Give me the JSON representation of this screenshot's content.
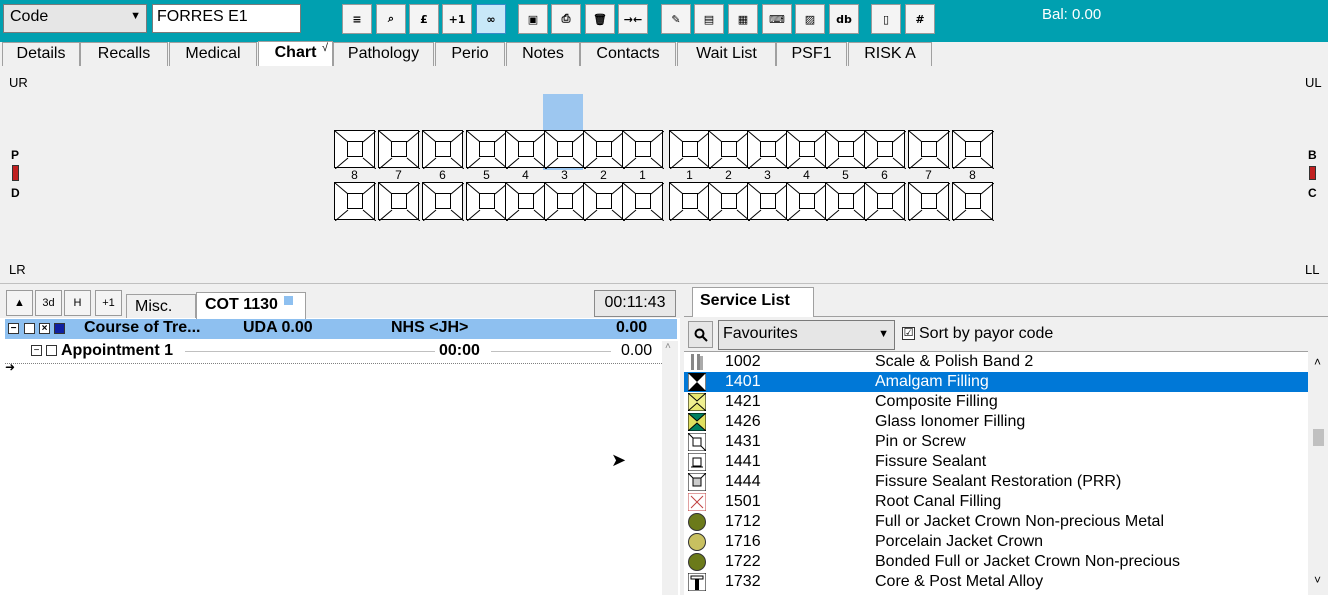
{
  "toolbar": {
    "code_combo": "Code",
    "patient_field": "FORRES E1",
    "balance": "Bal: 0.00",
    "buttons": [
      {
        "name": "align-icon",
        "glyph": "≡"
      },
      {
        "name": "search-icon",
        "glyph": "⌕"
      },
      {
        "name": "pound-icon",
        "glyph": "£"
      },
      {
        "name": "plus-one-icon",
        "glyph": "+1"
      },
      {
        "name": "link-icon",
        "glyph": "∞"
      },
      {
        "name": "save-icon",
        "glyph": "▣"
      },
      {
        "name": "print-icon",
        "glyph": "⎙"
      },
      {
        "name": "delete-icon",
        "glyph": "🗑"
      },
      {
        "name": "arrows-icon",
        "glyph": "→←"
      },
      {
        "name": "pen-icon",
        "glyph": "✎"
      },
      {
        "name": "document-icon",
        "glyph": "▤"
      },
      {
        "name": "documents-icon",
        "glyph": "▦"
      },
      {
        "name": "keyboard-icon",
        "glyph": "⌨"
      },
      {
        "name": "note-icon",
        "glyph": "▨"
      },
      {
        "name": "db-icon",
        "glyph": "db"
      },
      {
        "name": "page-icon",
        "glyph": "▯"
      },
      {
        "name": "grid-icon",
        "glyph": "#"
      }
    ]
  },
  "tabs": [
    "Details",
    "Recalls",
    "Medical",
    "Chart",
    "Pathology",
    "Perio",
    "Notes",
    "Contacts",
    "Wait List",
    "PSF1",
    "RISK A"
  ],
  "active_tab": "Chart",
  "active_tab_mark": "√",
  "chart": {
    "quadrants": {
      "ur": "UR",
      "ul": "UL",
      "lr": "LR",
      "ll": "LL"
    },
    "left_side": [
      "P",
      "D"
    ],
    "right_side": [
      "B",
      "C"
    ],
    "upper_left_numbers": [
      "8",
      "7",
      "6",
      "5",
      "4",
      "3",
      "2",
      "1"
    ],
    "upper_right_numbers": [
      "1",
      "2",
      "3",
      "4",
      "5",
      "6",
      "7",
      "8"
    ]
  },
  "course": {
    "buttons": [
      "▲",
      "3d",
      "H",
      "+1"
    ],
    "tabs": [
      "Misc.",
      "COT 1130"
    ],
    "timer": "00:11:43",
    "header": {
      "title": "Course of Tre...",
      "uda": "UDA 0.00",
      "nhs": "NHS <JH>",
      "amount": "0.00"
    },
    "appointment": {
      "label": "Appointment 1",
      "time": "00:00",
      "amount": "0.00"
    }
  },
  "service": {
    "tab": "Service List",
    "filter": "Favourites",
    "sort_label": "Sort by payor code",
    "sort_checked": "☑",
    "items": [
      {
        "code": "1002",
        "desc": "Scale & Polish Band 2",
        "icon": "scale"
      },
      {
        "code": "1401",
        "desc": "Amalgam Filling",
        "icon": "amalgam",
        "selected": true
      },
      {
        "code": "1421",
        "desc": "Composite Filling",
        "icon": "composite"
      },
      {
        "code": "1426",
        "desc": "Glass Ionomer Filling",
        "icon": "glass"
      },
      {
        "code": "1431",
        "desc": "Pin or Screw",
        "icon": "pin"
      },
      {
        "code": "1441",
        "desc": "Fissure Sealant",
        "icon": "fissure"
      },
      {
        "code": "1444",
        "desc": "Fissure Sealant Restoration (PRR)",
        "icon": "fissure2"
      },
      {
        "code": "1501",
        "desc": "Root Canal Filling",
        "icon": "root"
      },
      {
        "code": "1712",
        "desc": "Full or Jacket Crown Non-precious Metal",
        "icon": "crown-dark"
      },
      {
        "code": "1716",
        "desc": "Porcelain Jacket Crown",
        "icon": "crown-light"
      },
      {
        "code": "1722",
        "desc": "Bonded Full or Jacket Crown Non-precious",
        "icon": "crown-dark"
      },
      {
        "code": "1732",
        "desc": "Core & Post Metal Alloy",
        "icon": "post"
      }
    ]
  }
}
